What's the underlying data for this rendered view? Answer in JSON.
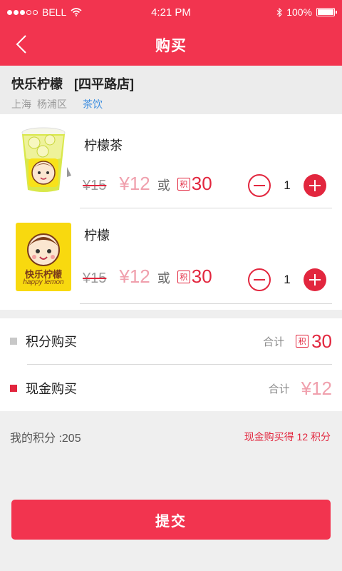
{
  "status": {
    "carrier": "BELL",
    "time": "4:21 PM",
    "battery": "100%"
  },
  "nav": {
    "title": "购买"
  },
  "store": {
    "name": "快乐柠檬",
    "branch": "[四平路店]",
    "city": "上海",
    "district": "杨浦区",
    "category": "茶饮"
  },
  "products": [
    {
      "name": "柠檬茶",
      "old_price": "¥15",
      "price": "¥12",
      "or": "或",
      "points_badge": "积",
      "points": "30",
      "quantity": "1"
    },
    {
      "name": "柠檬",
      "old_price": "¥15",
      "price": "¥12",
      "or": "或",
      "points_badge": "积",
      "points": "30",
      "quantity": "1",
      "logo_text": "快乐柠檬",
      "logo_subtext": "happy lemon"
    }
  ],
  "purchase_options": {
    "points": {
      "label": "积分购买",
      "total_label": "合计",
      "badge": "积",
      "value": "30",
      "marker_color": "#c8c8c8"
    },
    "cash": {
      "label": "现金购买",
      "total_label": "合计",
      "value": "¥12",
      "marker_color": "#e2263e"
    }
  },
  "footer": {
    "my_points": "我的积分 :205",
    "cash_reward": "现金购买得 12 积分"
  },
  "submit": {
    "label": "提交"
  },
  "colors": {
    "brand": "#f2344f",
    "accent": "#e2263e",
    "price_pink": "#f0a0ad",
    "link_blue": "#3b8de0"
  }
}
